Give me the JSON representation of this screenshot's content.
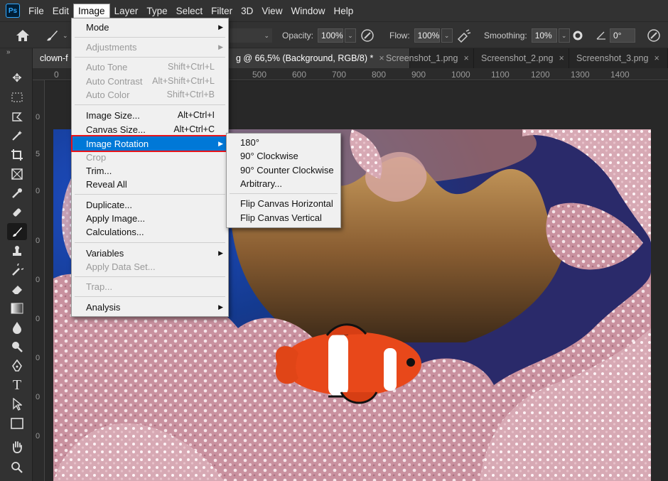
{
  "app": {
    "logo": "Ps"
  },
  "menubar": {
    "items": [
      "File",
      "Edit",
      "Image",
      "Layer",
      "Type",
      "Select",
      "Filter",
      "3D",
      "View",
      "Window",
      "Help"
    ],
    "active": "Image"
  },
  "options": {
    "opacity_label": "Opacity:",
    "opacity_value": "100%",
    "flow_label": "Flow:",
    "flow_value": "100%",
    "smoothing_label": "Smoothing:",
    "smoothing_value": "10%",
    "angle_value": "0°"
  },
  "tabs": [
    {
      "label": "clown-f",
      "close": ""
    },
    {
      "label": "g @ 66,5% (Background, RGB/8) *",
      "close": "×"
    },
    {
      "label": "Screenshot_1.png",
      "close": "×"
    },
    {
      "label": "Screenshot_2.png",
      "close": "×"
    },
    {
      "label": "Screenshot_3.png",
      "close": "×"
    }
  ],
  "ruler": {
    "top_labels": [
      "0",
      "500",
      "600",
      "700",
      "800",
      "900",
      "1000",
      "1100",
      "1200",
      "1300",
      "1400"
    ],
    "left_labels": [
      "0",
      "5",
      "0",
      "0",
      "0",
      "0",
      "0",
      "0",
      "0"
    ]
  },
  "image_menu": {
    "mode": "Mode",
    "adjustments": "Adjustments",
    "auto_tone": "Auto Tone",
    "auto_tone_sc": "Shift+Ctrl+L",
    "auto_contrast": "Auto Contrast",
    "auto_contrast_sc": "Alt+Shift+Ctrl+L",
    "auto_color": "Auto Color",
    "auto_color_sc": "Shift+Ctrl+B",
    "image_size": "Image Size...",
    "image_size_sc": "Alt+Ctrl+I",
    "canvas_size": "Canvas Size...",
    "canvas_size_sc": "Alt+Ctrl+C",
    "image_rotation": "Image Rotation",
    "crop": "Crop",
    "trim": "Trim...",
    "reveal_all": "Reveal All",
    "duplicate": "Duplicate...",
    "apply_image": "Apply Image...",
    "calculations": "Calculations...",
    "variables": "Variables",
    "apply_data_set": "Apply Data Set...",
    "trap": "Trap...",
    "analysis": "Analysis"
  },
  "rotation_submenu": {
    "r180": "180°",
    "r90cw": "90° Clockwise",
    "r90ccw": "90° Counter Clockwise",
    "arbitrary": "Arbitrary...",
    "flip_h": "Flip Canvas Horizontal",
    "flip_v": "Flip Canvas Vertical"
  },
  "colors": {
    "menu_highlight": "#0078d7",
    "highlight_outline": "#e8141b",
    "ps_blue": "#31a8ff"
  }
}
